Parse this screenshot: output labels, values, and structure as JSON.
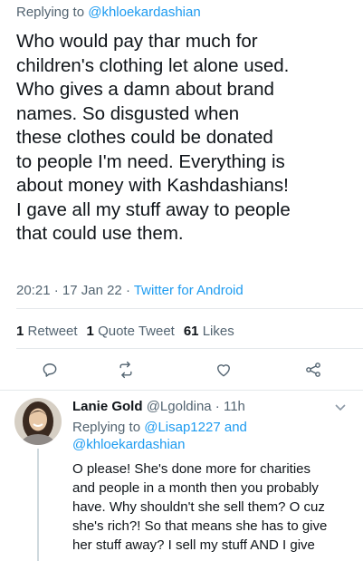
{
  "main_tweet": {
    "replying_prefix": "Replying to ",
    "replying_handle": "@khloekardashian",
    "text": "Who would pay thar much for\nchildren's clothing let alone used.\nWho gives a damn about brand\nnames.  So disgusted when\nthese clothes could be donated\nto people I'm need.  Everything is\nabout money with Kashdashians!\nI gave all my stuff away to people\nthat could use them.",
    "time": "20:21",
    "sep1": " · ",
    "date": "17 Jan 22",
    "sep2": " · ",
    "source": "Twitter for Android",
    "stats": {
      "retweets_count": "1",
      "retweets_label": "Retweet",
      "quotes_count": "1",
      "quotes_label": "Quote Tweet",
      "likes_count": "61",
      "likes_label": "Likes"
    }
  },
  "actions": {
    "icons": [
      "reply-icon",
      "retweet-icon",
      "like-icon",
      "share-icon"
    ],
    "icon_color": "#536471"
  },
  "reply_tweet": {
    "name": "Lanie Gold",
    "handle": "@Lgoldina",
    "sep": " · ",
    "time": "11h",
    "replying_prefix": "Replying to ",
    "replying_handle_1": "@Lisap1227",
    "replying_and": " and",
    "replying_handle_2": "@khloekardashian",
    "text": "O please! She's done more for charities\nand people in a month then you probably\nhave. Why shouldn't she sell them? O cuz\nshe's rich?! So that means she has to give\nher stuff away? I sell my stuff AND I give"
  },
  "colors": {
    "link": "#1d9bf0",
    "secondary_text": "#536471",
    "primary_text": "#0f1419",
    "divider": "#e4e8eb"
  }
}
